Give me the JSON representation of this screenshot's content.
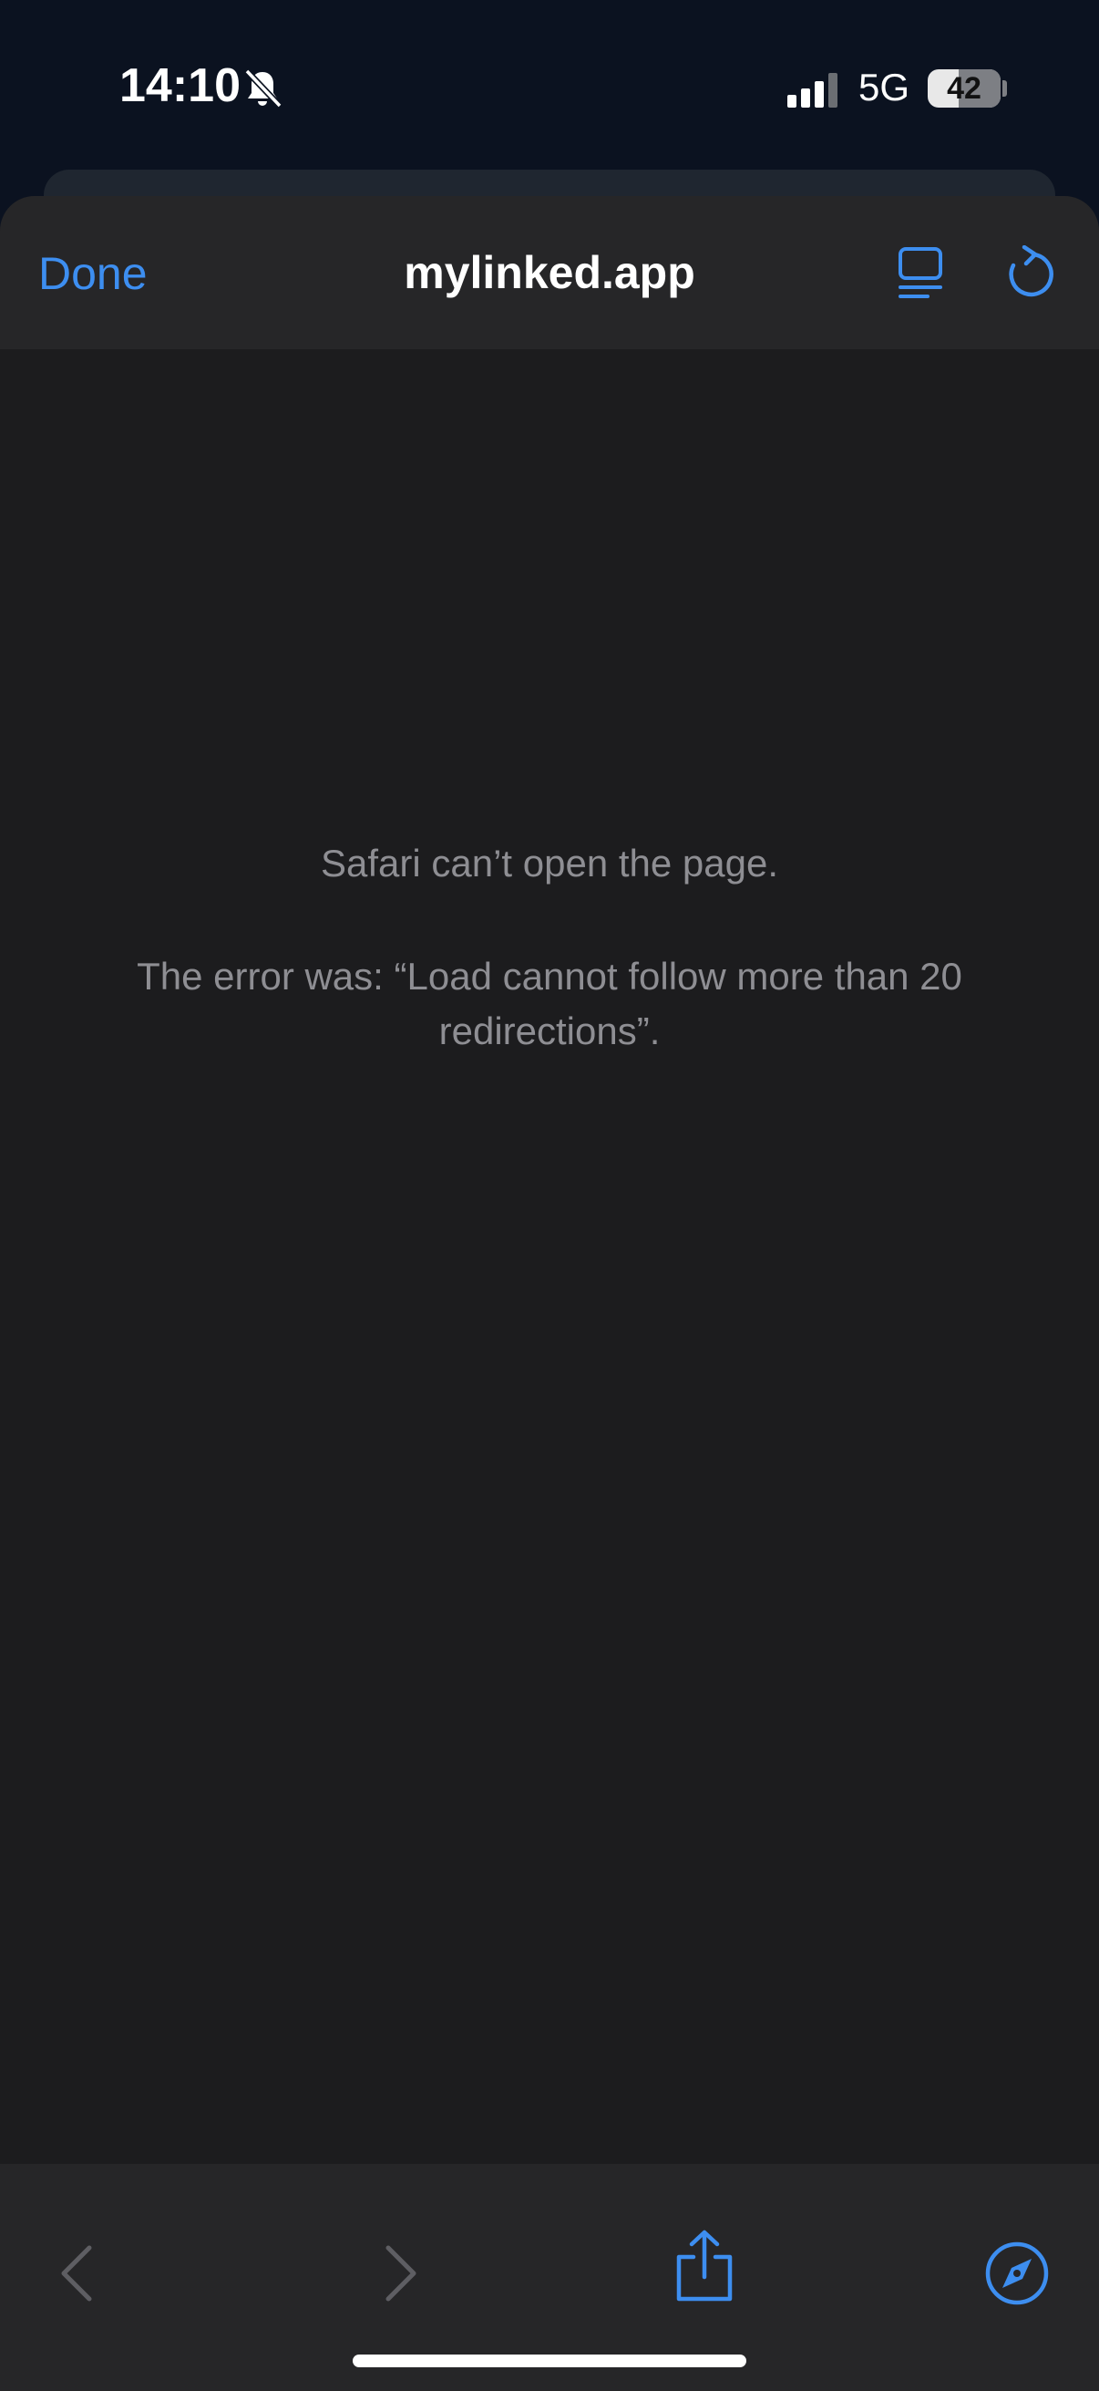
{
  "status_bar": {
    "time": "14:10",
    "network": "5G",
    "battery": "42",
    "icons": [
      "bell-off-icon",
      "signal-icon",
      "battery-icon"
    ]
  },
  "nav": {
    "done_label": "Done",
    "title": "mylinked.app",
    "icons": [
      "reader-icon",
      "reload-icon"
    ]
  },
  "error": {
    "title": "Safari can’t open the page.",
    "detail": "The error was: “Load cannot follow more than 20 redirections”."
  },
  "toolbar": {
    "icons": [
      "chevron-left-icon",
      "chevron-right-icon",
      "share-icon",
      "compass-icon"
    ]
  },
  "colors": {
    "accent": "#3d8ef0",
    "background": "#1c1c1e",
    "bar": "#262628",
    "error_text": "#8e8e93"
  }
}
